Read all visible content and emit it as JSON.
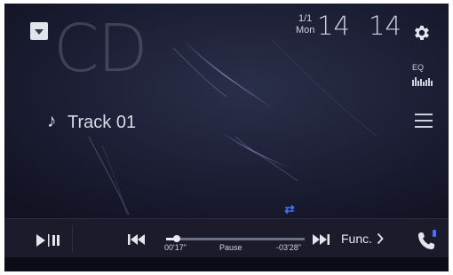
{
  "source": {
    "name": "CD",
    "toggle_icon": "chevron-down-icon"
  },
  "header": {
    "date_month": "1/1",
    "date_day": "Mon",
    "clock_hour": "14",
    "clock_minute": "14",
    "settings_icon": "gear-icon"
  },
  "side": {
    "eq_label": "EQ",
    "eq_icon": "equalizer-icon",
    "list_icon": "list-icon"
  },
  "track": {
    "note_icon": "music-note-icon",
    "title": "Track 01"
  },
  "playback": {
    "play_pause_icon": "play-pause-icon",
    "prev_icon": "skip-previous-icon",
    "next_icon": "skip-next-icon",
    "repeat_icon": "repeat-icon",
    "elapsed": "00'17\"",
    "status": "Pause",
    "remaining": "-03'28\"",
    "progress": 0.075,
    "func_label": "Func.",
    "func_icon": "chevron-right-icon",
    "phone_icon": "phone-icon"
  },
  "colors": {
    "background": "#151526",
    "text": "#cfd2dc",
    "accent_blue": "#4a6fff",
    "bar": "#1b1b2c"
  }
}
